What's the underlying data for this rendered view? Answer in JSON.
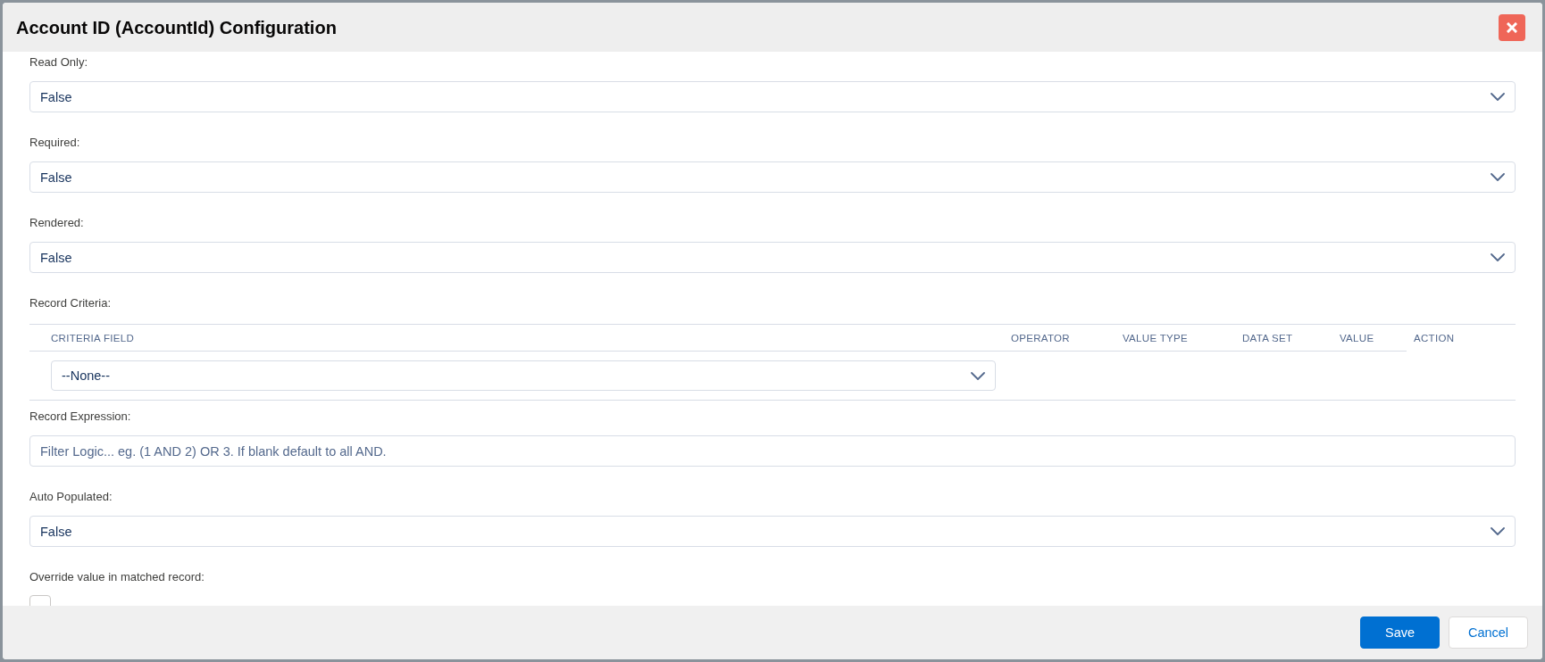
{
  "modal": {
    "title": "Account ID (AccountId) Configuration"
  },
  "fields": [
    {
      "kind": "select",
      "label": "Read Only:",
      "value": "False"
    },
    {
      "kind": "select",
      "label": "Required:",
      "value": "False"
    },
    {
      "kind": "select",
      "label": "Rendered:",
      "value": "False"
    },
    {
      "kind": "criteria",
      "label": "Record Criteria:",
      "columns": [
        "CRITERIA FIELD",
        "OPERATOR",
        "VALUE TYPE",
        "DATA SET",
        "VALUE",
        "ACTION"
      ],
      "rows": [
        {
          "criteria_field": "--None--"
        }
      ]
    },
    {
      "kind": "text",
      "label": "Record Expression:",
      "placeholder": "Filter Logic... eg. (1 AND 2) OR 3. If blank default to all AND."
    },
    {
      "kind": "select",
      "label": "Auto Populated:",
      "value": "False"
    },
    {
      "kind": "checkbox",
      "label": "Override value in matched record:",
      "checked": false
    }
  ],
  "footer": {
    "buttons": [
      {
        "label": "Save",
        "kind": "primary"
      },
      {
        "label": "Cancel",
        "kind": "neutral"
      }
    ]
  }
}
